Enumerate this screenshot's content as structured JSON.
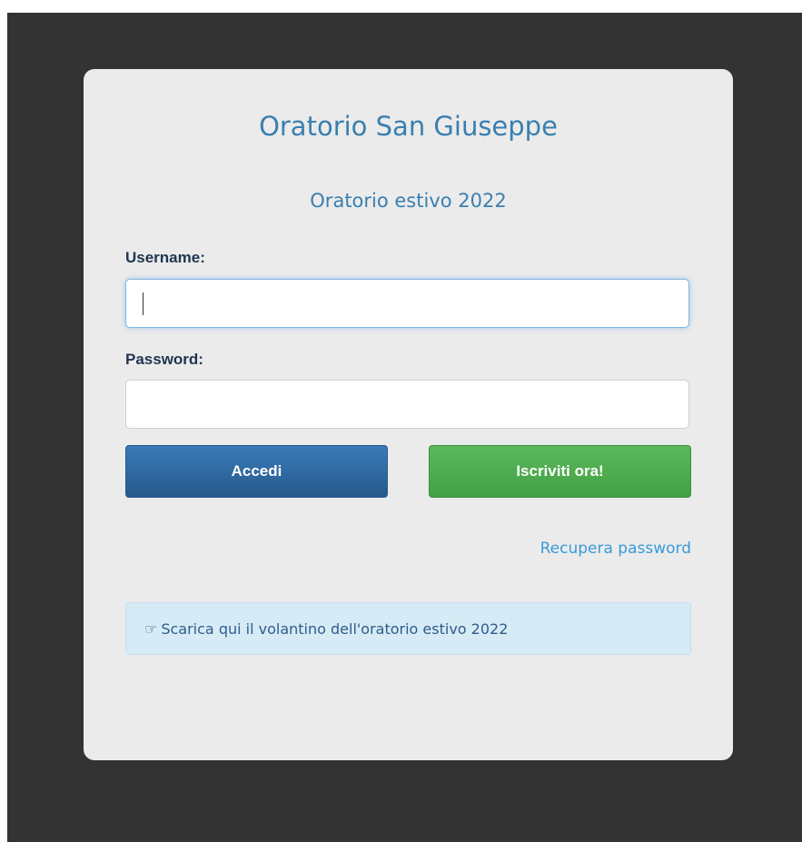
{
  "header": {
    "title": "Oratorio San Giuseppe",
    "subtitle": "Oratorio estivo 2022"
  },
  "form": {
    "username_label": "Username:",
    "username_value": "",
    "password_label": "Password:",
    "password_value": ""
  },
  "buttons": {
    "login_label": "Accedi",
    "register_label": "Iscriviti ora!"
  },
  "links": {
    "recover_password": "Recupera password"
  },
  "notice": {
    "icon": "hand-point-right-icon",
    "text": "Scarica qui il volantino dell'oratorio estivo 2022"
  },
  "colors": {
    "accent_blue": "#3a7fb0",
    "primary_button": "#2f6ea5",
    "success_button": "#4cae4c",
    "info_background": "#d6ebf6",
    "backdrop": "#333333",
    "card_background": "#ebebeb"
  }
}
